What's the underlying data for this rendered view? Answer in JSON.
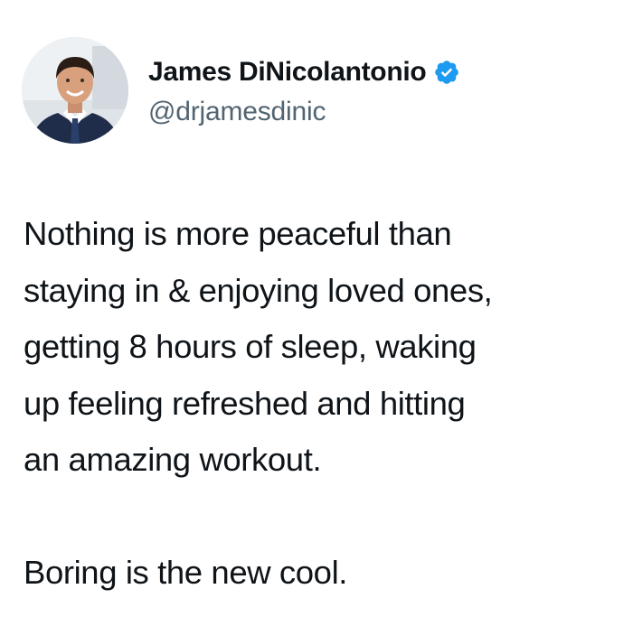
{
  "author": {
    "display_name": "James DiNicolantonio",
    "handle": "@drjamesdinic",
    "verified": true,
    "verified_color": "#1d9bf0"
  },
  "tweet": {
    "lines": [
      "Nothing is more peaceful than",
      "staying in & enjoying loved ones,",
      "getting 8 hours of sleep, waking",
      "up feeling refreshed and hitting",
      "an amazing workout.",
      "Boring is the new cool."
    ]
  },
  "icons": {
    "verified": "verified-badge-icon",
    "avatar": "profile-photo"
  }
}
